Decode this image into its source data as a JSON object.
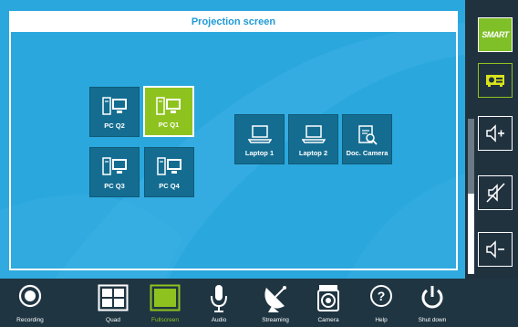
{
  "panel": {
    "title": "Projection screen"
  },
  "sources": {
    "pcs": [
      {
        "label": "PC Q2",
        "icon": "pc-icon",
        "selected": false
      },
      {
        "label": "PC Q1",
        "icon": "pc-icon",
        "selected": true
      },
      {
        "label": "PC Q3",
        "icon": "pc-icon",
        "selected": false
      },
      {
        "label": "PC Q4",
        "icon": "pc-icon",
        "selected": false
      }
    ],
    "others": [
      {
        "label": "Laptop 1",
        "icon": "laptop-icon"
      },
      {
        "label": "Laptop 2",
        "icon": "laptop-icon"
      },
      {
        "label": "Doc. Camera",
        "icon": "document-camera-icon"
      }
    ]
  },
  "right_panel": {
    "smart_logo": "SMART",
    "volume_level": 0.52,
    "buttons": [
      "projector-icon",
      "volume-up-icon",
      "mute-icon",
      "volume-down-icon"
    ]
  },
  "toolbar": {
    "recording": "Recording",
    "quad": "Quad",
    "fullscreen": "Fullscreen",
    "audio": "Audio",
    "streaming": "Streaming",
    "camera": "Camera",
    "help": "Help",
    "shutdown": "Shut down"
  },
  "colors": {
    "background_blue": "#2aa7dd",
    "tile": "#146d91",
    "selected_green": "#8ec31f",
    "toolbar": "#1f3542",
    "title_text": "#1e9ad6"
  }
}
